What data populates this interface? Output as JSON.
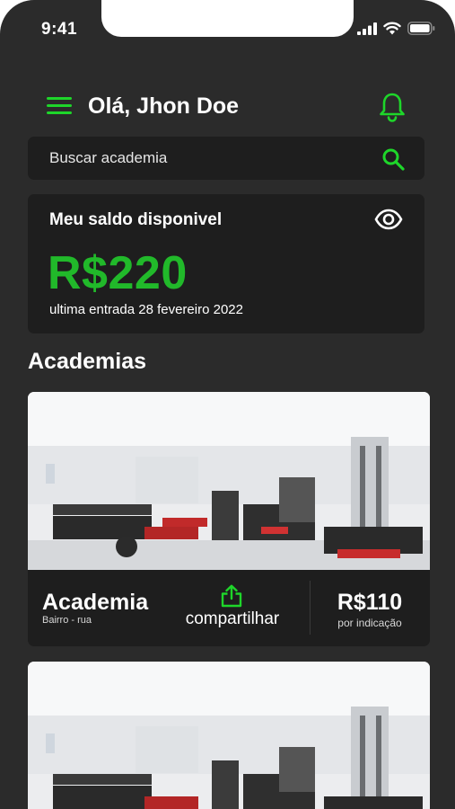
{
  "status_bar": {
    "time": "9:41",
    "icons": [
      "signal-icon",
      "wifi-icon",
      "battery-icon"
    ]
  },
  "header": {
    "greeting": "Olá, Jhon Doe",
    "menu_icon": "hamburger-icon",
    "bell_icon": "bell-icon"
  },
  "search": {
    "placeholder": "Buscar academia",
    "icon": "search-icon"
  },
  "balance": {
    "title": "Meu saldo disponivel",
    "amount": "R$220",
    "last_entry": "ultima entrada 28 fevereiro 2022",
    "visibility_icon": "eye-icon"
  },
  "section": {
    "title": "Academias"
  },
  "gyms": [
    {
      "name": "Academia",
      "address": "Bairro - rua",
      "share_label": "compartilhar",
      "price": "R$110",
      "price_note": "por indicação"
    },
    {
      "name": "",
      "address": "",
      "share_label": "",
      "price": "",
      "price_note": ""
    }
  ],
  "colors": {
    "background": "#2b2b2b",
    "card": "#1e1e1e",
    "accent": "#1ed62a",
    "amount": "#21b92a",
    "text": "#ffffff"
  }
}
